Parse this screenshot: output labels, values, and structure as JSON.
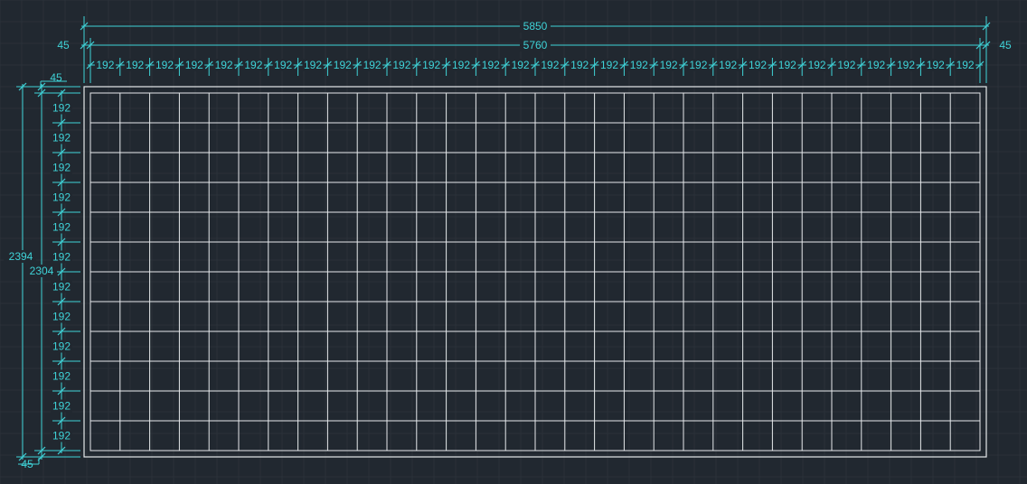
{
  "drawing": {
    "overall_width_label": "5850",
    "inner_width_label": "5760",
    "overall_height_label": "2394",
    "inner_height_label": "2304",
    "margin_label": "45",
    "column_count": 30,
    "row_count": 12,
    "cell_label": "192"
  },
  "colors": {
    "background": "#212830",
    "dimension": "#3fd3d8",
    "geometry": "#e6e9ec",
    "grid_minor": "#2a3139"
  }
}
